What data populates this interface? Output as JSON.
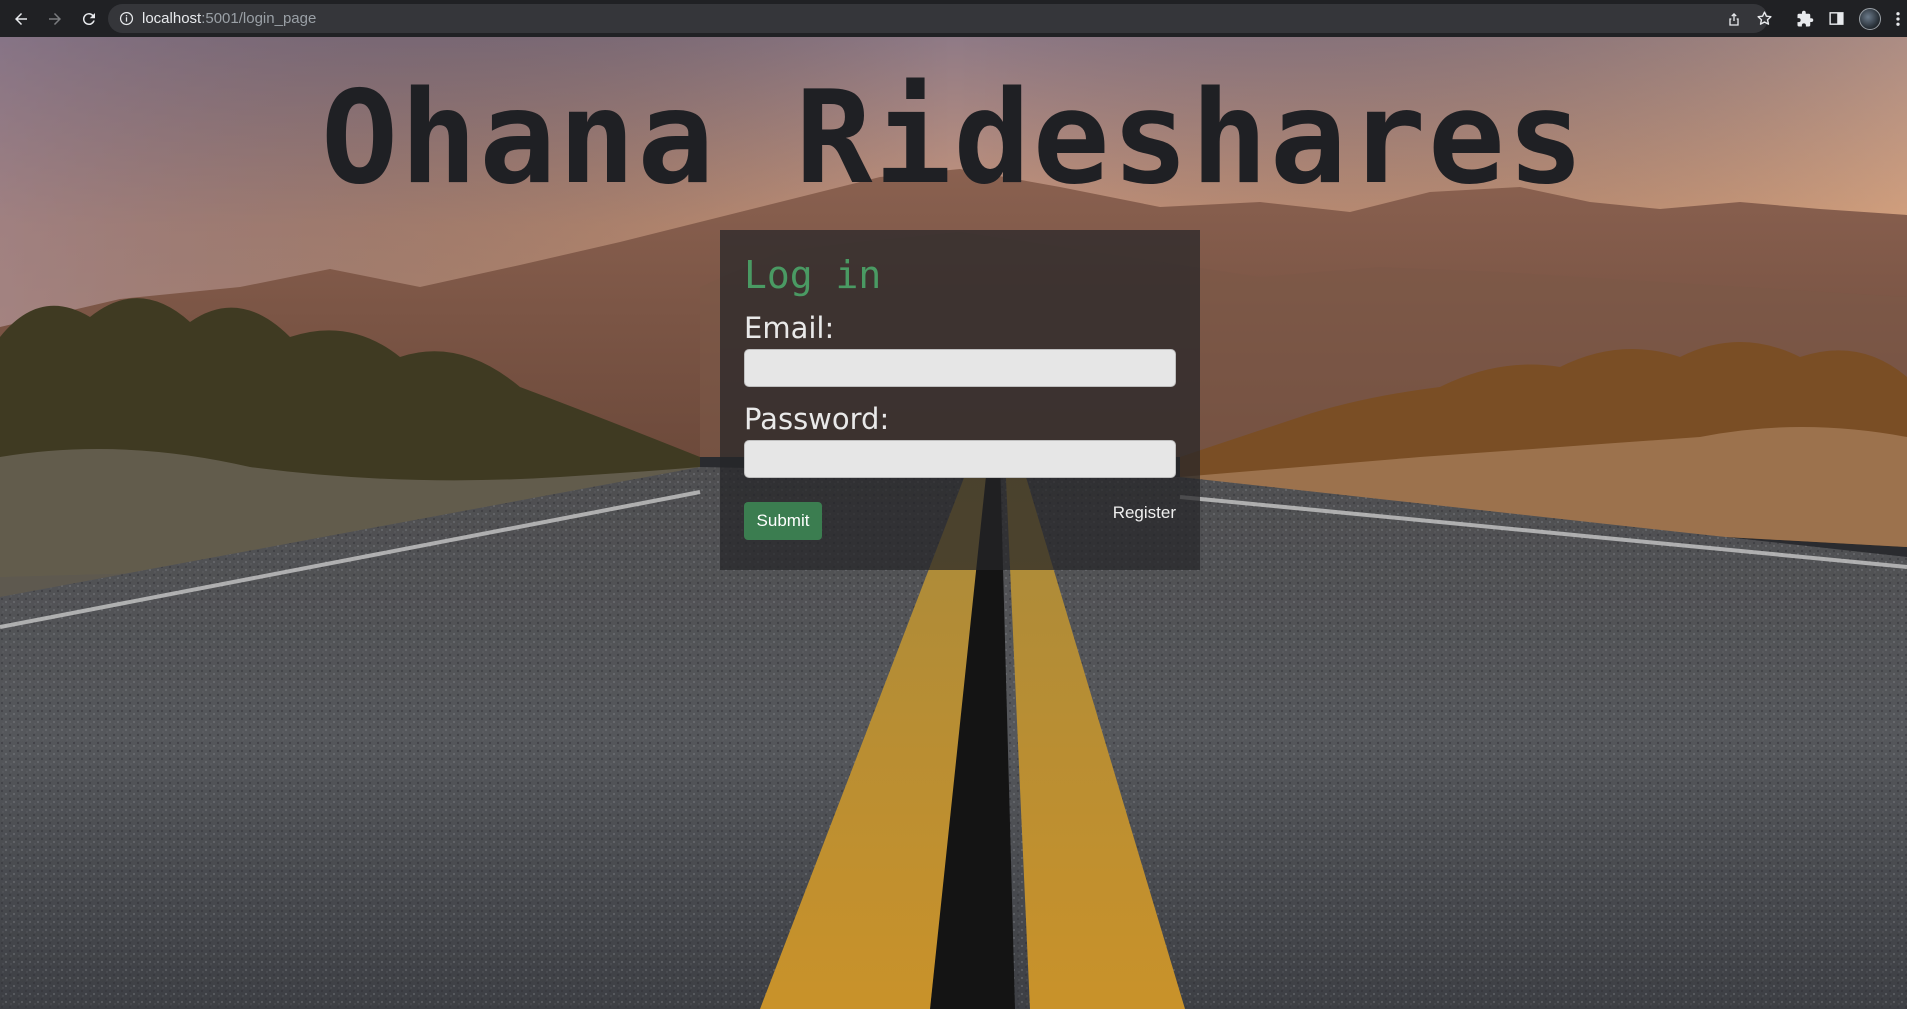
{
  "browser": {
    "url_host": "localhost",
    "url_path": ":5001/login_page"
  },
  "page": {
    "site_title": "Ohana Rideshares"
  },
  "login_form": {
    "heading": "Log in",
    "email_label": "Email:",
    "email_value": "",
    "password_label": "Password:",
    "password_value": "",
    "submit_label": "Submit",
    "register_label": "Register"
  },
  "colors": {
    "heading_green": "#4a9a63",
    "submit_green": "#3b7d50",
    "title_dark": "#1f2024"
  },
  "icons": {
    "back": "arrow-left-icon",
    "forward": "arrow-right-icon",
    "reload": "reload-icon",
    "site_info": "info-icon",
    "share": "share-icon",
    "bookmark": "star-icon",
    "extensions": "puzzle-icon",
    "side_panel": "side-panel-icon",
    "menu": "kebab-menu-icon"
  }
}
